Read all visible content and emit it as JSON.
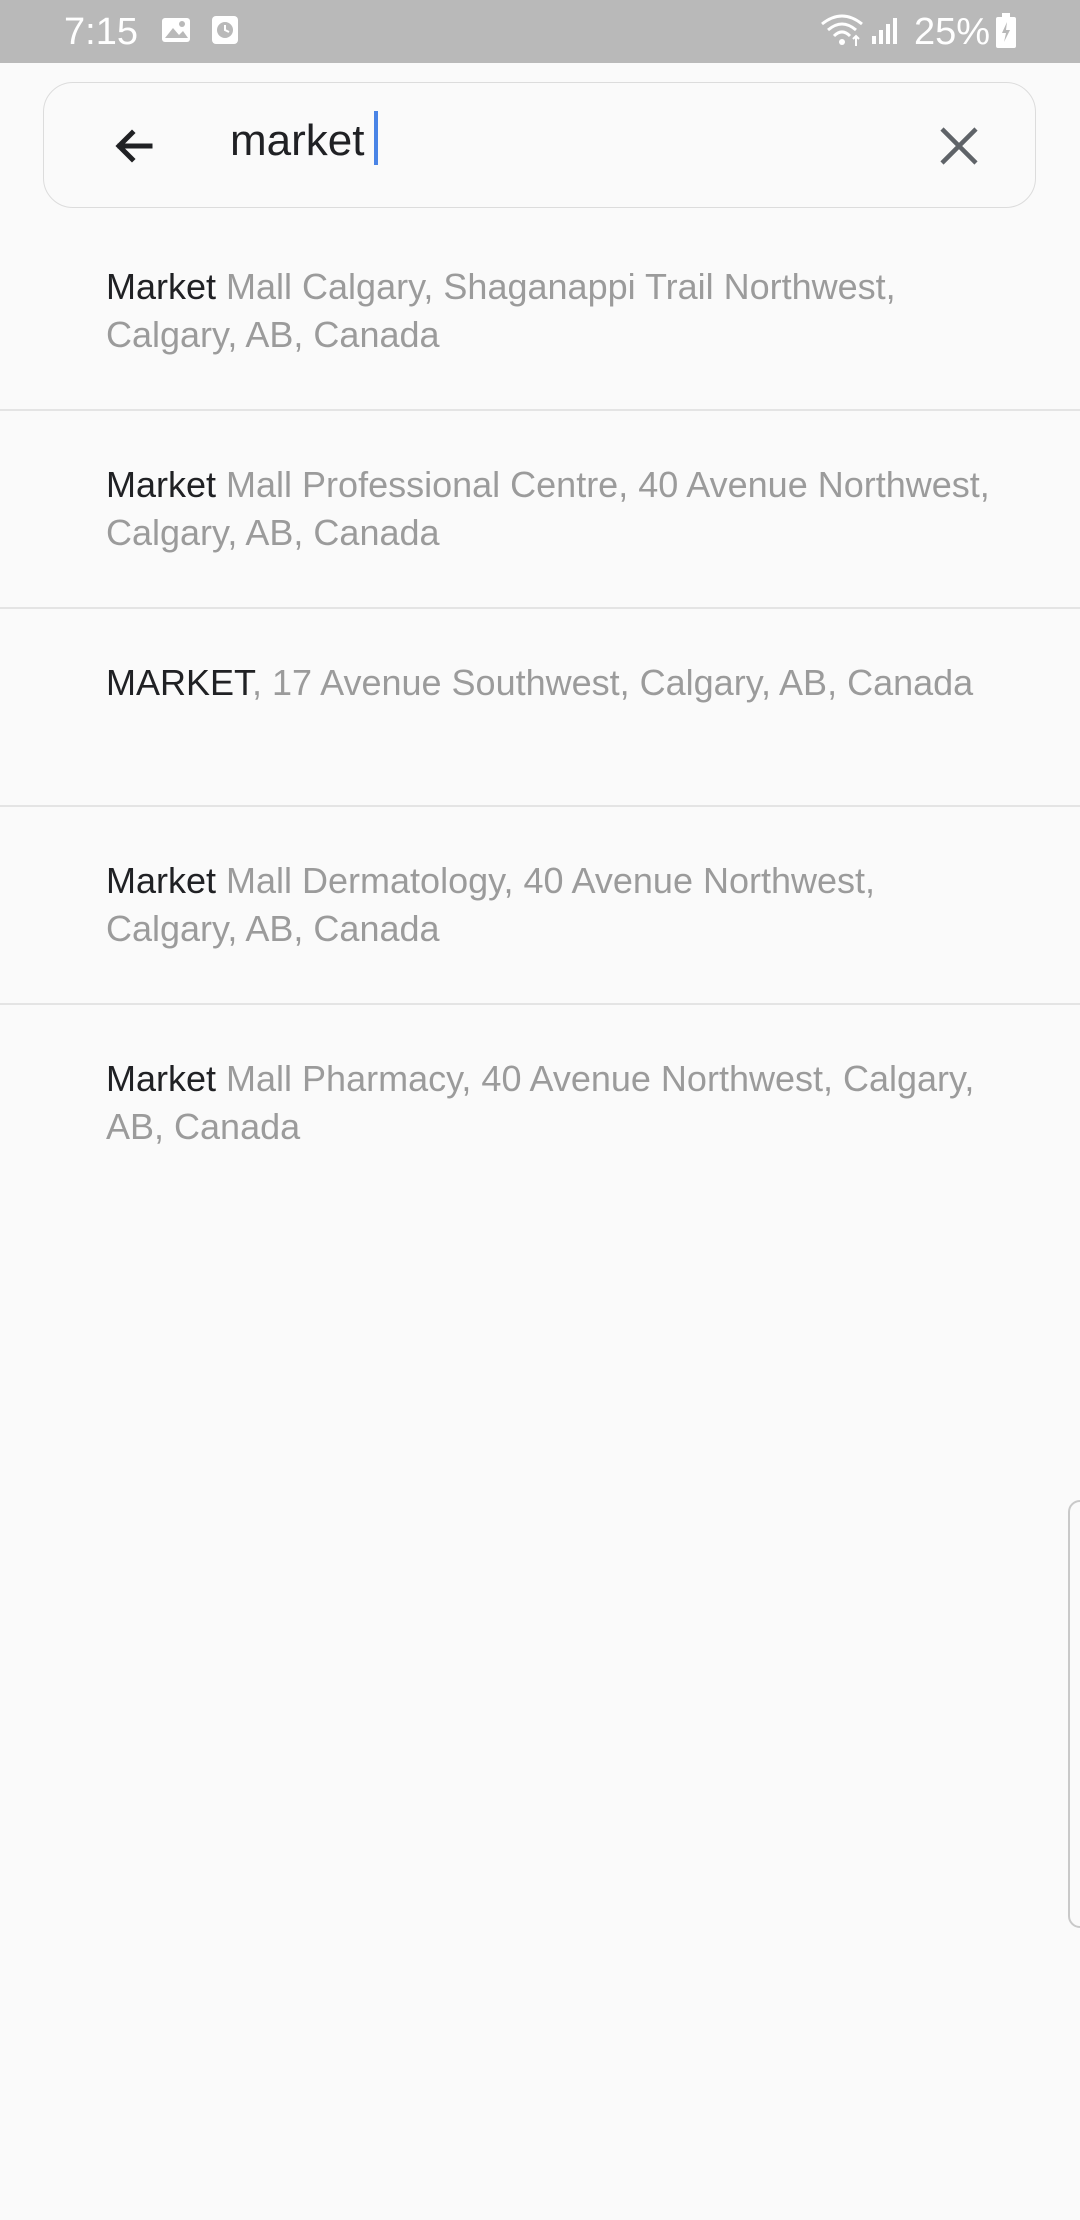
{
  "status_bar": {
    "time": "7:15",
    "battery": "25%",
    "icons": [
      "image-icon",
      "clock-app-icon",
      "wifi-icon",
      "signal-icon",
      "battery-charging-icon"
    ]
  },
  "search": {
    "value": "market",
    "back_icon": "back-arrow-icon",
    "clear_icon": "close-icon",
    "caret_color": "#4a84e6"
  },
  "results": [
    {
      "match": "Market",
      "rest": " Mall Calgary, Shaganappi Trail Northwest, Calgary, AB, Canada"
    },
    {
      "match": "Market",
      "rest": " Mall Professional Centre, 40 Avenue Northwest, Calgary, AB, Canada"
    },
    {
      "match": "MARKET",
      "rest": ", 17 Avenue Southwest, Calgary, AB, Canada"
    },
    {
      "match": "Market",
      "rest": " Mall Dermatology, 40 Avenue Northwest, Calgary, AB, Canada"
    },
    {
      "match": "Market",
      "rest": " Mall Pharmacy, 40 Avenue Northwest, Calgary, AB, Canada"
    }
  ],
  "colors": {
    "status_bar_bg": "#b9b9b9",
    "page_bg": "#fafafa",
    "match_text": "#202124",
    "secondary_text": "#9b9b9b",
    "divider": "#e4e4e4"
  }
}
